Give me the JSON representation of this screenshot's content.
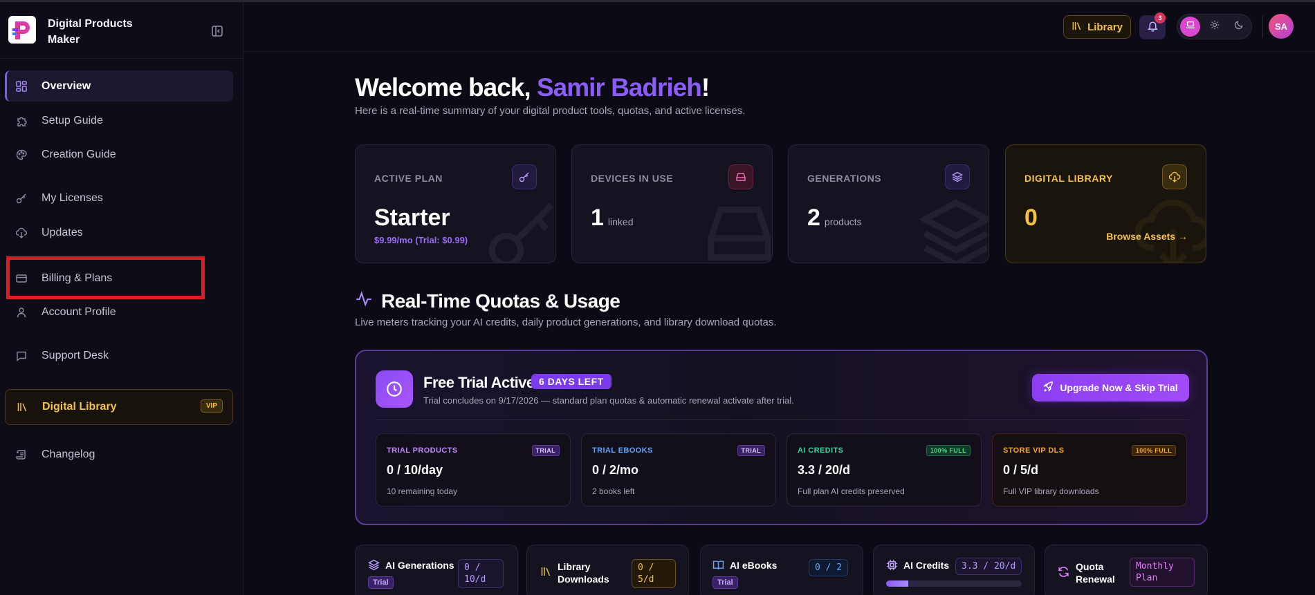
{
  "app": {
    "name": "Digital Products Maker"
  },
  "sidebar": {
    "items": [
      {
        "label": "Overview",
        "icon": "grid-icon"
      },
      {
        "label": "Setup Guide",
        "icon": "puzzle-icon"
      },
      {
        "label": "Creation Guide",
        "icon": "palette-icon"
      },
      {
        "label": "My Licenses",
        "icon": "key-icon"
      },
      {
        "label": "Updates",
        "icon": "cloud-download-icon"
      },
      {
        "label": "Billing & Plans",
        "icon": "credit-card-icon"
      },
      {
        "label": "Account Profile",
        "icon": "user-icon"
      },
      {
        "label": "Support Desk",
        "icon": "chat-icon"
      },
      {
        "label": "Digital Library",
        "icon": "library-icon",
        "badge": "VIP"
      },
      {
        "label": "Changelog",
        "icon": "scroll-icon"
      }
    ]
  },
  "topbar": {
    "library_label": "Library",
    "notification_count": "3",
    "avatar_initials": "SA"
  },
  "welcome": {
    "prefix": "Welcome back,",
    "name": "Samir Badrieh",
    "suffix": "!",
    "subtitle": "Here is a real-time summary of your digital product tools, quotas, and active licenses."
  },
  "stats": [
    {
      "title": "ACTIVE PLAN",
      "value": "Starter",
      "price": "$9.99/mo (Trial: $0.99)",
      "icon": "key-icon"
    },
    {
      "title": "DEVICES IN USE",
      "value": "1",
      "unit": "linked",
      "icon": "hard-drive-icon"
    },
    {
      "title": "GENERATIONS",
      "value": "2",
      "unit": "products",
      "icon": "layers-icon"
    },
    {
      "title": "DIGITAL LIBRARY",
      "value": "0",
      "link": "Browse Assets →",
      "icon": "cloud-download-icon"
    }
  ],
  "quotas": {
    "title": "Real-Time Quotas & Usage",
    "subtitle": "Live meters tracking your AI credits, daily product generations, and library download quotas."
  },
  "trial": {
    "title": "Free Trial Active",
    "days_badge": "6 DAYS LEFT",
    "subtitle": "Trial concludes on 9/17/2026 — standard plan quotas & automatic renewal activate after trial.",
    "upgrade_label": "Upgrade Now & Skip Trial",
    "cards": [
      {
        "title": "TRIAL PRODUCTS",
        "badge": "TRIAL",
        "value": "0 / 10/day",
        "note": "10 remaining today"
      },
      {
        "title": "TRIAL EBOOKS",
        "badge": "TRIAL",
        "value": "0 / 2/mo",
        "note": "2 books left"
      },
      {
        "title": "AI CREDITS",
        "badge": "100% FULL",
        "value": "3.3 / 20/d",
        "note": "Full plan AI credits preserved"
      },
      {
        "title": "STORE VIP DLS",
        "badge": "100% FULL",
        "value": "0 / 5/d",
        "note": "Full VIP library downloads"
      }
    ]
  },
  "quota_cards": [
    {
      "title": "AI Generations",
      "pill": "0 / 10/d",
      "badge": "Trial"
    },
    {
      "title": "Library Downloads",
      "pill": "0 / 5/d"
    },
    {
      "title": "AI eBooks",
      "pill": "0 / 2",
      "badge": "Trial"
    },
    {
      "title": "AI Credits",
      "pill": "3.3 / 20/d",
      "progress": 0.165
    },
    {
      "title": "Quota Renewal",
      "pill": "Monthly Plan"
    }
  ],
  "colors": {
    "accent_purple": "#8b5cf6",
    "gold": "#f5c243",
    "green": "#34d399",
    "highlight_red": "#e01b24"
  }
}
